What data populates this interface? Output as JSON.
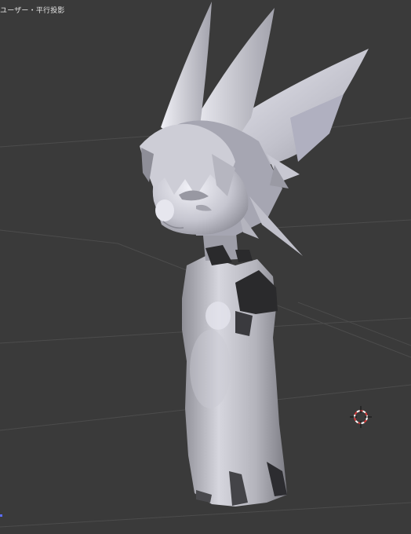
{
  "viewport": {
    "label": "ユーザー・平行投影"
  },
  "colors": {
    "background": "#3a3a3a",
    "grid_line": "#4a4a4a",
    "model_light": "#e4e4ec",
    "model_mid": "#b4b4be",
    "model_shadow": "#7a7a82",
    "model_dark": "#262628",
    "cursor_red": "#d23c3c",
    "cursor_white": "#ffffff"
  },
  "icons": {
    "cursor": "3d-cursor-icon"
  }
}
